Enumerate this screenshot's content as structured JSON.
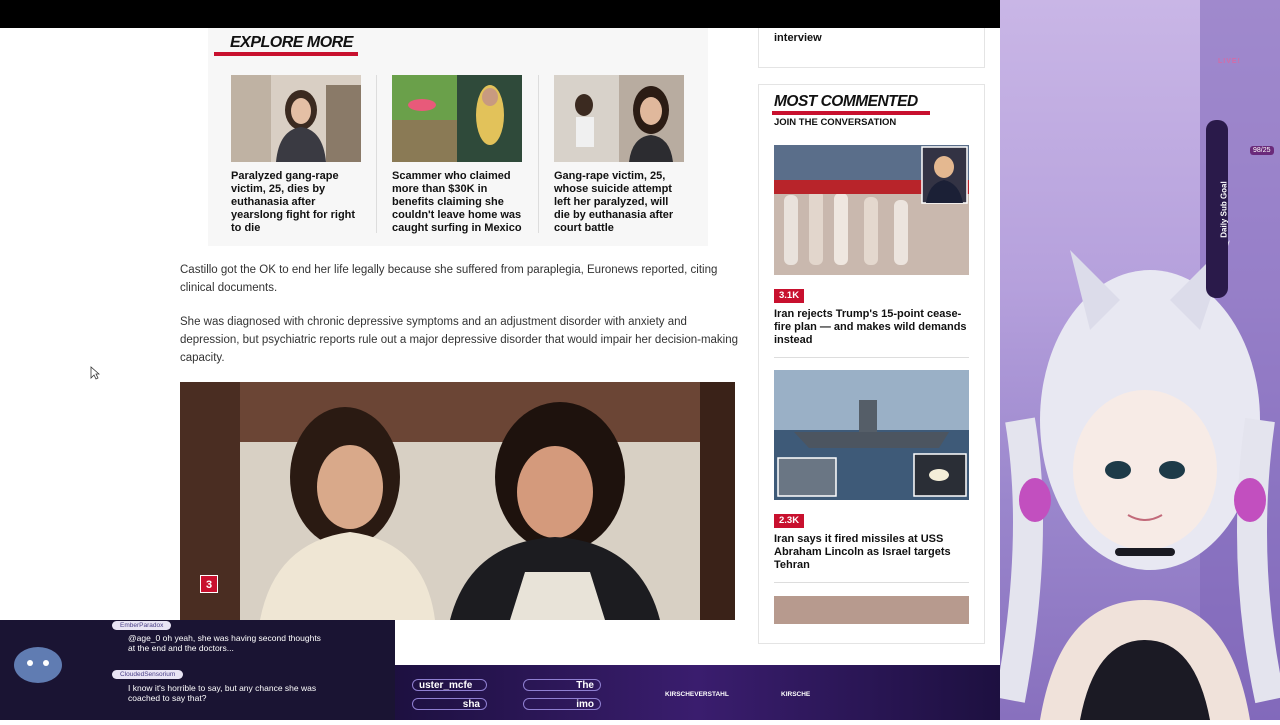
{
  "explore": {
    "title": "EXPLORE MORE",
    "cards": [
      {
        "headline": "Paralyzed gang-rape victim, 25, dies by euthanasia after yearslong fight for right to die"
      },
      {
        "headline": "Scammer who claimed more than $30K in benefits claiming she couldn't leave home was caught surfing in Mexico"
      },
      {
        "headline": "Gang-rape victim, 25, whose suicide attempt left her paralyzed, will die by euthanasia after court battle"
      }
    ]
  },
  "article": {
    "para1": "Castillo got the OK to end her life legally because she suffered from paraplegia, Euronews reported, citing clinical documents.",
    "para2": "She was diagnosed with chronic depressive symptoms and an adjustment disorder with anxiety and depression, but psychiatric reports rule out a major depressive disorder that would impair her decision-making capacity.",
    "photo_number": "3"
  },
  "sidebar": {
    "prev_item_tail": "interview",
    "most_commented_title": "MOST COMMENTED",
    "join_label": "JOIN THE CONVERSATION",
    "items": [
      {
        "count": "3.1K",
        "headline": "Iran rejects Trump's 15-point cease-fire plan — and makes wild demands instead"
      },
      {
        "count": "2.3K",
        "headline": "Iran says it fired missiles at USS Abraham Lincoln as Israel targets Tehran"
      }
    ]
  },
  "stream": {
    "live_label": "LIVE!",
    "goal_label": "Daily Sub Goal",
    "goal_count": "98/25",
    "chat": [
      {
        "user": "EmberParadox",
        "text": "@age_0 oh yeah, she was having second thoughts at the end and the doctors..."
      },
      {
        "user": "CloudedSensorium",
        "text": "I know it's horrible to say, but any chance she was coached to say that?"
      }
    ],
    "ticker": {
      "pill1": "uster_mcfe",
      "pill2": "The",
      "pill3": "sha",
      "pill4": "imo",
      "handle1": "KIRSCHEVERSTAHL",
      "handle2": "KIRSCHE"
    }
  },
  "colors": {
    "accent": "#c8102e",
    "overlay": "#b5a0dc"
  }
}
